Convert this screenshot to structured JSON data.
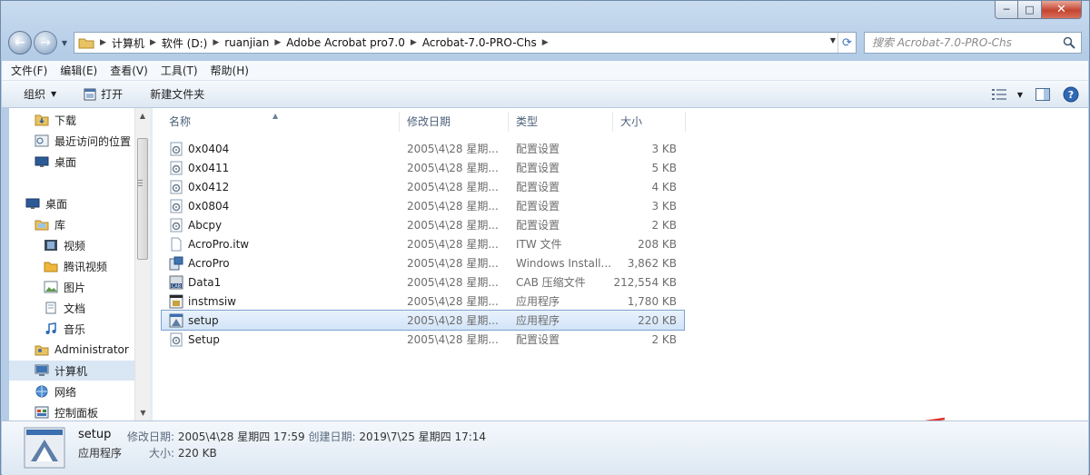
{
  "window": {
    "controls": {
      "min": "─",
      "max": "□",
      "close": "✕"
    }
  },
  "address": {
    "crumbs": [
      "计算机",
      "软件 (D:)",
      "ruanjian",
      "Adobe Acrobat pro7.0",
      "Acrobat-7.0-PRO-Chs"
    ]
  },
  "search": {
    "placeholder": "搜索 Acrobat-7.0-PRO-Chs"
  },
  "menu": [
    "文件(F)",
    "编辑(E)",
    "查看(V)",
    "工具(T)",
    "帮助(H)"
  ],
  "toolbar": {
    "organize": "组织",
    "open": "打开",
    "new_folder": "新建文件夹"
  },
  "nav": {
    "favorites": [
      "下载",
      "最近访问的位置",
      "桌面"
    ],
    "desktop": "桌面",
    "libraries": "库",
    "library_items": [
      "视频",
      "腾讯视频",
      "图片",
      "文档",
      "音乐"
    ],
    "admin": "Administrator",
    "computer": "计算机",
    "network": "网络",
    "control_panel": "控制面板"
  },
  "columns": {
    "name": "名称",
    "date": "修改日期",
    "type": "类型",
    "size": "大小"
  },
  "files": [
    {
      "name": "0x0404",
      "date": "2005\\4\\28 星期...",
      "type": "配置设置",
      "size": "3 KB",
      "icon": "config-icon"
    },
    {
      "name": "0x0411",
      "date": "2005\\4\\28 星期...",
      "type": "配置设置",
      "size": "5 KB",
      "icon": "config-icon"
    },
    {
      "name": "0x0412",
      "date": "2005\\4\\28 星期...",
      "type": "配置设置",
      "size": "4 KB",
      "icon": "config-icon"
    },
    {
      "name": "0x0804",
      "date": "2005\\4\\28 星期...",
      "type": "配置设置",
      "size": "3 KB",
      "icon": "config-icon"
    },
    {
      "name": "Abcpy",
      "date": "2005\\4\\28 星期...",
      "type": "配置设置",
      "size": "2 KB",
      "icon": "config-icon"
    },
    {
      "name": "AcroPro.itw",
      "date": "2005\\4\\28 星期...",
      "type": "ITW 文件",
      "size": "208 KB",
      "icon": "document-icon"
    },
    {
      "name": "AcroPro",
      "date": "2005\\4\\28 星期...",
      "type": "Windows Install...",
      "size": "3,862 KB",
      "icon": "installer-icon"
    },
    {
      "name": "Data1",
      "date": "2005\\4\\28 星期...",
      "type": "CAB 压缩文件",
      "size": "212,554 KB",
      "icon": "cab-icon"
    },
    {
      "name": "instmsiw",
      "date": "2005\\4\\28 星期...",
      "type": "应用程序",
      "size": "1,780 KB",
      "icon": "app-icon"
    },
    {
      "name": "setup",
      "date": "2005\\4\\28 星期...",
      "type": "应用程序",
      "size": "220 KB",
      "icon": "setup-exe-icon"
    },
    {
      "name": "Setup",
      "date": "2005\\4\\28 星期...",
      "type": "配置设置",
      "size": "2 KB",
      "icon": "config-icon"
    }
  ],
  "selected_index": 9,
  "details": {
    "name": "setup",
    "type": "应用程序",
    "modified_label": "修改日期:",
    "modified": "2005\\4\\28 星期四 17:59",
    "created_label": "创建日期:",
    "created": "2019\\7\\25 星期四 17:14",
    "size_label": "大小:",
    "size": "220 KB"
  },
  "colors": {
    "annotation_arrow": "#e0302a",
    "selection": "#d2e4f8"
  }
}
